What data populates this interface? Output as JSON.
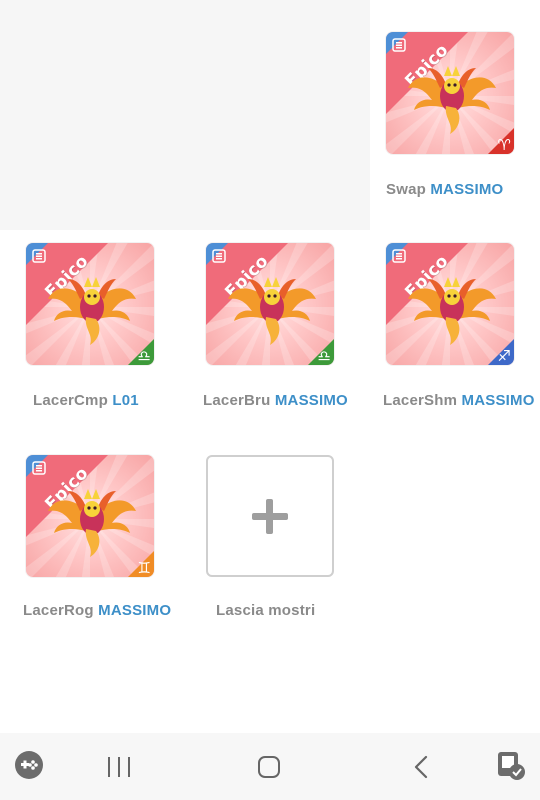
{
  "cards": [
    {
      "id": "swap",
      "name": "Swap",
      "owner": "MASSIMO",
      "rarity": "Epico",
      "element": "fire",
      "element_symbol": "♈",
      "element_color": "#d8322a"
    },
    {
      "id": "lacercmp",
      "name": "LacerCmp",
      "owner": "L01",
      "rarity": "Epico",
      "element": "earth",
      "element_symbol": "♎",
      "element_color": "#3d9a3a"
    },
    {
      "id": "lacerbru",
      "name": "LacerBru",
      "owner": "MASSIMO",
      "rarity": "Epico",
      "element": "earth",
      "element_symbol": "♎",
      "element_color": "#3d9a3a"
    },
    {
      "id": "lacershm",
      "name": "LacerShm",
      "owner": "MASSIMO",
      "rarity": "Epico",
      "element": "water",
      "element_symbol": "♐",
      "element_color": "#3e69c8"
    },
    {
      "id": "lacerrog",
      "name": "LacerRog",
      "owner": "MASSIMO",
      "rarity": "Epico",
      "element": "air",
      "element_symbol": "♊",
      "element_color": "#f08c25"
    }
  ],
  "add_card": {
    "label": "Lascia mostri"
  },
  "colors": {
    "owner": "#3d8fc8",
    "name": "#8a8a8a",
    "ribbon": "#f06b7a",
    "corner": "#4e8fd6"
  },
  "navbar": {
    "items": [
      {
        "icon": "gamepad-icon"
      },
      {
        "icon": "recent-apps-icon"
      },
      {
        "icon": "home-icon"
      },
      {
        "icon": "back-icon"
      },
      {
        "icon": "assistant-icon"
      }
    ]
  }
}
